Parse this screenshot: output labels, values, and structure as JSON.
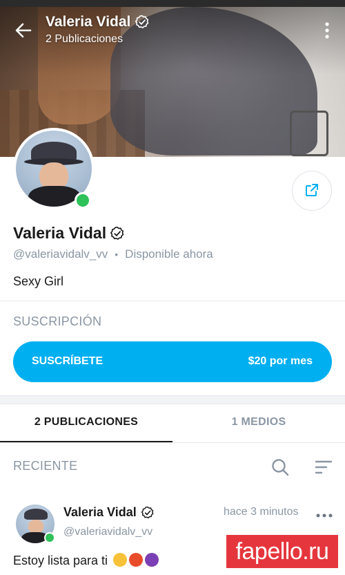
{
  "header": {
    "name": "Valeria Vidal",
    "post_count_label": "2 Publicaciones"
  },
  "profile": {
    "name": "Valeria Vidal",
    "handle": "@valeriavidalv_vv",
    "separator": "•",
    "availability": "Disponible ahora",
    "bio": "Sexy Girl",
    "online": true
  },
  "subscription": {
    "section_label": "SUSCRIPCIÓN",
    "button_label": "SUSCRÍBETE",
    "price_label": "$20 por mes"
  },
  "tabs": [
    {
      "label": "2 PUBLICACIONES",
      "active": true
    },
    {
      "label": "1 MEDIOS",
      "active": false
    }
  ],
  "feed": {
    "filter_label": "RECIENTE",
    "posts": [
      {
        "author": "Valeria Vidal",
        "handle": "@valeriavidalv_vv",
        "time": "hace 3 minutos",
        "text": "Estoy lista para ti",
        "emojis": [
          "grimacing-face",
          "angry-face",
          "smiling-devil"
        ]
      }
    ]
  },
  "watermark": "fapello.ru",
  "icons": [
    "back-arrow-icon",
    "verified-icon",
    "more-vertical-icon",
    "share-icon",
    "search-icon",
    "sort-icon",
    "more-horizontal-icon"
  ],
  "colors": {
    "accent": "#00aff0",
    "online": "#2fc15a",
    "muted_text": "#8a96a3",
    "watermark_bg": "#e5363d"
  }
}
